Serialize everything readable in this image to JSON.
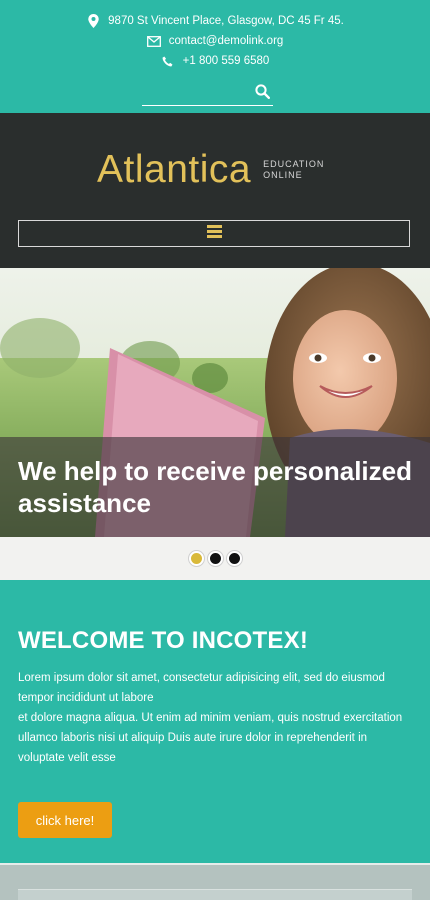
{
  "contact": {
    "address": "9870 St Vincent Place, Glasgow, DC 45 Fr 45.",
    "email": "contact@demolink.org",
    "phone": "+1 800 559 6580"
  },
  "search": {
    "value": "",
    "placeholder": "",
    "icon": "search-icon"
  },
  "logo": {
    "name": "Atlantica",
    "tagline_line1": "EDUCATION",
    "tagline_line2": "ONLINE"
  },
  "nav": {
    "icon": "hamburger-menu-icon"
  },
  "hero": {
    "title": "We help to receive personalized assistance",
    "dots": [
      {
        "active": true
      },
      {
        "active": false
      },
      {
        "active": false
      }
    ]
  },
  "welcome": {
    "title": "WELCOME TO INCOTEX!",
    "paragraph1": "Lorem ipsum dolor sit amet, consectetur adipisicing elit, sed do eiusmod tempor incididunt ut labore",
    "paragraph2": "et dolore magna aliqua. Ut enim ad minim veniam, quis nostrud exercitation ullamco laboris nisi ut aliquip Duis aute irure dolor in reprehenderit in voluptate velit esse",
    "button_label": "click here!"
  },
  "colors": {
    "teal": "#2cb9a6",
    "dark_header": "#2a2e2d",
    "logo_gold": "#e2c15a",
    "button_orange": "#ec9e12",
    "active_dot": "#d9b93a"
  }
}
